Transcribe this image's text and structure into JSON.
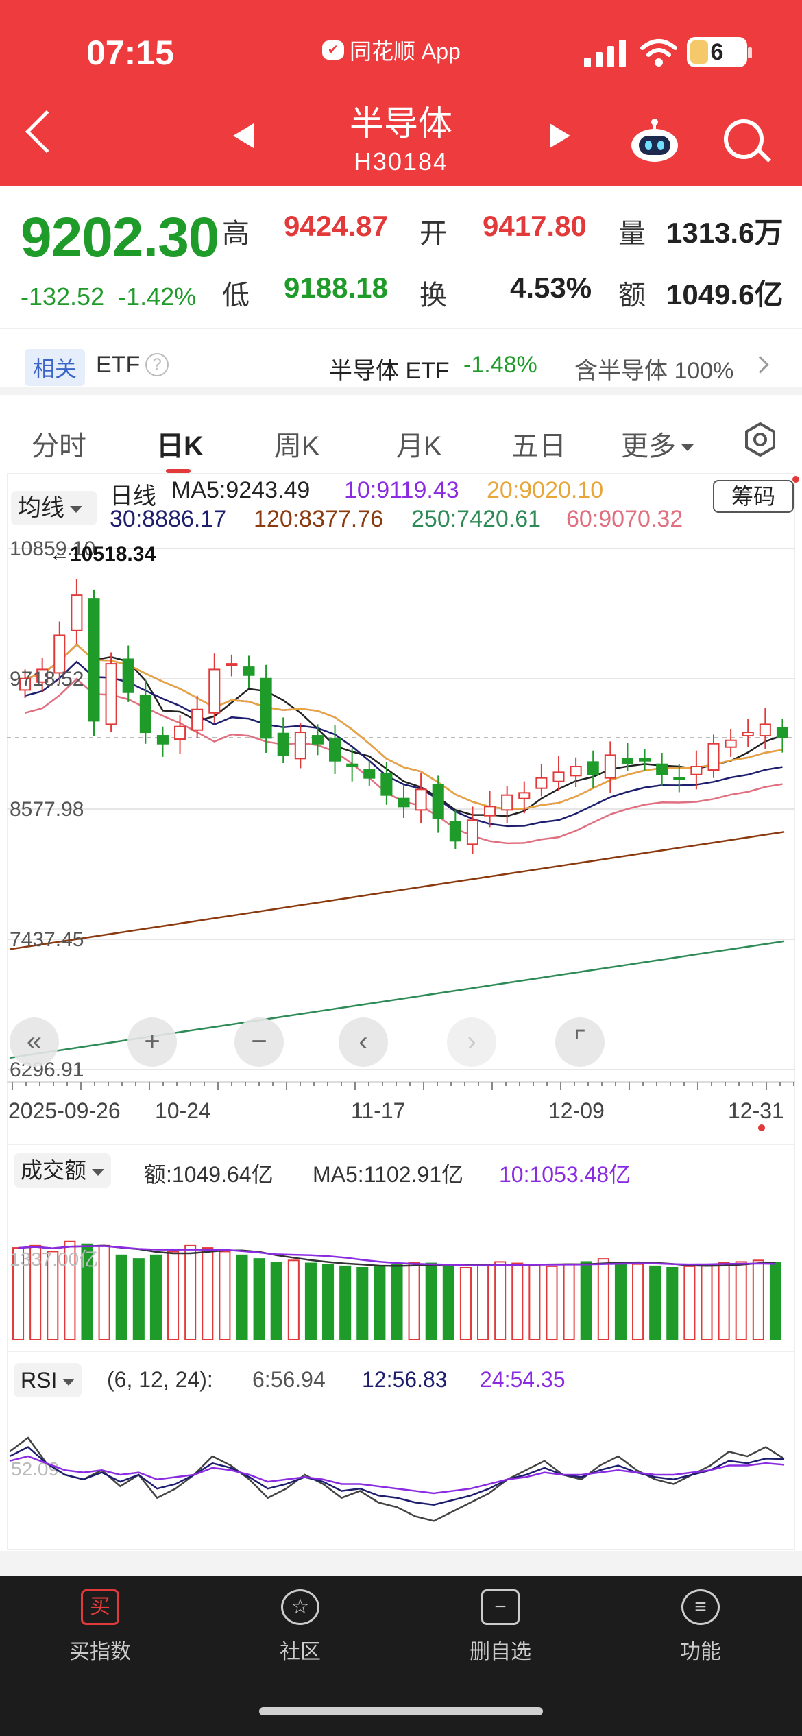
{
  "status": {
    "time": "07:15",
    "app": "同花顺 App",
    "battery": "6"
  },
  "header": {
    "title": "半导体",
    "code": "H30184"
  },
  "quote": {
    "price": "9202.30",
    "change": "-132.52",
    "change_pct": "-1.42%",
    "high_label": "高",
    "high": "9424.87",
    "open_label": "开",
    "open": "9417.80",
    "vol_label": "量",
    "vol": "1313.6万",
    "low_label": "低",
    "low": "9188.18",
    "turn_label": "换",
    "turn": "4.53%",
    "amt_label": "额",
    "amt": "1049.6亿"
  },
  "related": {
    "tag": "相关",
    "etf": "ETF",
    "etf_name": "半导体 ETF",
    "etf_pct": "-1.48%",
    "holding": "含半导体 100%"
  },
  "tabs": [
    "分时",
    "日K",
    "周K",
    "月K",
    "五日",
    "更多"
  ],
  "kline": {
    "ma_select": "均线",
    "period": "日线",
    "ma5": "MA5:9243.49",
    "ma10": "10:9119.43",
    "ma20": "20:9020.10",
    "ma30": "30:8886.17",
    "ma120": "120:8377.76",
    "ma250": "250:7420.61",
    "ma60": "60:9070.32",
    "chips_btn": "筹码",
    "y_labels": [
      "10859.10",
      "9718.52",
      "8577.98",
      "7437.45",
      "6296.91"
    ],
    "max_marker": "←10518.34",
    "dates": [
      "2025-09-26",
      "10-24",
      "11-17",
      "12-09",
      "12-31"
    ]
  },
  "volume": {
    "select": "成交额",
    "amount": "额:1049.64亿",
    "ma5": "MA5:1102.91亿",
    "ma10": "10:1053.48亿",
    "y_label": "1337.00亿"
  },
  "rsi": {
    "select": "RSI",
    "params": "(6, 12, 24):",
    "r6": "6:56.94",
    "r12": "12:56.83",
    "r24": "24:54.35",
    "y_label": "52.09"
  },
  "tabbar": [
    {
      "label": "买指数",
      "icon": "买"
    },
    {
      "label": "社区",
      "icon": "☆"
    },
    {
      "label": "删自选",
      "icon": "−"
    },
    {
      "label": "功能",
      "icon": "≡"
    }
  ],
  "colors": {
    "up": "#e23a3a",
    "down": "#1f9b2a",
    "header": "#ee3b3e"
  },
  "chart_data": [
    {
      "type": "candlestick",
      "title": "日线",
      "x_range": [
        "2025-09-26",
        "12-31"
      ],
      "ylim": [
        6296.91,
        10859.1
      ],
      "series": [
        {
          "name": "MA5",
          "last": 9243.49
        },
        {
          "name": "MA10",
          "last": 9119.43
        },
        {
          "name": "MA20",
          "last": 9020.1
        },
        {
          "name": "MA30",
          "last": 8886.17
        },
        {
          "name": "MA60",
          "last": 9070.32
        },
        {
          "name": "MA120",
          "last": 8377.76
        },
        {
          "name": "MA250",
          "last": 7420.61
        }
      ],
      "close_values": [
        9720,
        9800,
        10100,
        10450,
        9350,
        9850,
        9600,
        9250,
        9150,
        9300,
        9450,
        9800,
        9850,
        9750,
        9200,
        9050,
        9250,
        9150,
        9000,
        8950,
        8850,
        8700,
        8600,
        8750,
        8500,
        8300,
        8480,
        8600,
        8700,
        8720,
        8850,
        8900,
        8950,
        8880,
        9050,
        8980,
        9000,
        8880,
        8840,
        8950,
        9150,
        9180,
        9250,
        9320,
        9202.3
      ]
    },
    {
      "type": "bar",
      "title": "成交额",
      "values": [
        1250,
        1280,
        1200,
        1337,
        1300,
        1280,
        1150,
        1100,
        1150,
        1200,
        1280,
        1250,
        1200,
        1150,
        1100,
        1050,
        1080,
        1040,
        1020,
        1000,
        980,
        1000,
        1020,
        1050,
        1040,
        1000,
        980,
        1020,
        1060,
        1040,
        1010,
        1000,
        1030,
        1060,
        1100,
        1050,
        1030,
        1000,
        980,
        1000,
        1020,
        1050,
        1060,
        1080,
        1049.64
      ]
    },
    {
      "type": "line",
      "title": "RSI",
      "series": [
        {
          "name": "6",
          "values": [
            60,
            66,
            55,
            50,
            48,
            52,
            45,
            50,
            40,
            44,
            50,
            58,
            54,
            48,
            40,
            44,
            50,
            46,
            40,
            43,
            38,
            36,
            32,
            30,
            34,
            38,
            42,
            48,
            52,
            56,
            50,
            48,
            54,
            58,
            52,
            48,
            46,
            50,
            54,
            60,
            58,
            62,
            56.94
          ]
        },
        {
          "name": "12",
          "values": [
            58,
            62,
            55,
            50,
            48,
            51,
            47,
            50,
            44,
            46,
            50,
            55,
            53,
            49,
            44,
            46,
            49,
            47,
            43,
            44,
            41,
            40,
            38,
            37,
            39,
            41,
            44,
            48,
            50,
            53,
            50,
            49,
            52,
            54,
            51,
            49,
            48,
            50,
            52,
            56,
            55,
            57,
            56.83
          ]
        },
        {
          "name": "24",
          "values": [
            56,
            58,
            55,
            52,
            51,
            52,
            50,
            51,
            48,
            49,
            50,
            53,
            52,
            50,
            47,
            48,
            49,
            48,
            46,
            46,
            45,
            44,
            43,
            42,
            43,
            44,
            46,
            48,
            49,
            51,
            50,
            50,
            51,
            52,
            51,
            50,
            50,
            51,
            52,
            54,
            54,
            55,
            54.35
          ]
        }
      ],
      "ylim": [
        20,
        80
      ]
    }
  ]
}
